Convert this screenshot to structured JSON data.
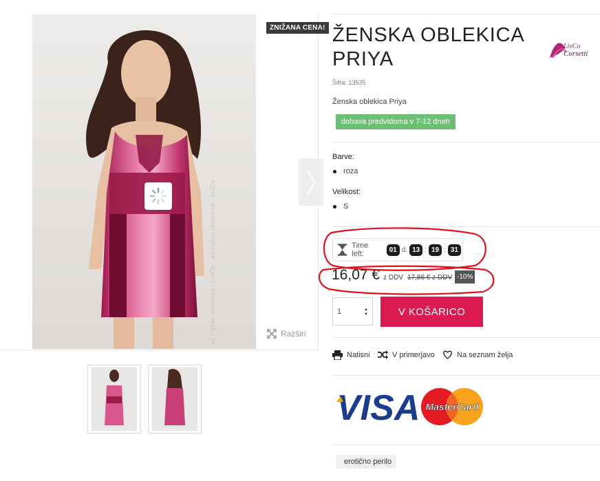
{
  "gallery": {
    "sale_badge": "ZNIŽANA CENA!",
    "zoom_label": "Razširi",
    "watermark": "all rights reserved - LivCo - all rights reserved - LivCo"
  },
  "product": {
    "title": "ŽENSKA OBLEKICA PRIYA",
    "brand": "LivCo Corsetti",
    "sku": "Šifra: 13535",
    "short_description": "Ženska oblekica Priya",
    "availability": "dobava predvidoma v 7-12 dneh"
  },
  "options": {
    "color_label": "Barve:",
    "color_value": "roza",
    "size_label": "Velikost:",
    "size_value": "S"
  },
  "countdown": {
    "label": "Time left:",
    "days": "01",
    "days_unit": "d.",
    "hours": "13",
    "minutes": "19",
    "seconds": "31"
  },
  "pricing": {
    "price": "16,07 €",
    "vat_note": "z DDV",
    "old_price": "17,86 € z DDV",
    "discount": "-10%"
  },
  "cart": {
    "quantity": "1",
    "add_to_cart": "V KOŠARICO"
  },
  "actions": {
    "print": "Natisni",
    "compare": "V primerjavo",
    "wishlist": "Na seznam želja"
  },
  "payment": {
    "visa": "VISA",
    "mastercard": "MasterCard"
  },
  "tags": [
    "erotično perilo"
  ],
  "colors": {
    "accent": "#dc1a52",
    "availability_bg": "#6cbf73",
    "annotation_red": "#e0101e",
    "dress_pink": "#d94a86"
  }
}
